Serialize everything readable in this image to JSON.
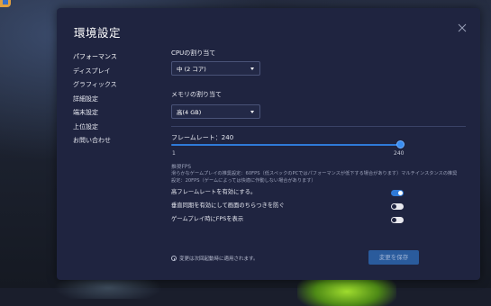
{
  "dialog": {
    "title": "環境設定"
  },
  "nav": {
    "items": [
      {
        "label": "パフォーマンス",
        "active": true
      },
      {
        "label": "ディスプレイ"
      },
      {
        "label": "グラフィックス"
      },
      {
        "label": "詳細設定"
      },
      {
        "label": "端末設定"
      },
      {
        "label": "上位設定"
      },
      {
        "label": "お問い合わせ"
      }
    ]
  },
  "cpu": {
    "label": "CPUの割り当て",
    "value": "中 (2 コア)"
  },
  "memory": {
    "label": "メモリの割り当て",
    "value": "高(4 GB)"
  },
  "frame_rate": {
    "label": "フレームレート：240",
    "min": "1",
    "max": "240",
    "value": 240
  },
  "recommended": {
    "title": "推奨FPS",
    "text": "滑らかなゲームプレイの推奨設定：60FPS（低スペックのPCではパフォーマンスが低下する場合があります）マルチインスタンスの推奨設定：20FPS（ゲームによっては快適に作動しない場合があります）"
  },
  "toggles": [
    {
      "label": "高フレームレートを有効にする。",
      "on": true
    },
    {
      "label": "垂直同期を有効にして画面のちらつきを防ぐ",
      "on": false
    },
    {
      "label": "ゲームプレイ時にFPSを表示",
      "on": false
    }
  ],
  "footer": {
    "note": "変更は次回起動時に適用されます。",
    "save_label": "変更を保存"
  },
  "colors": {
    "accent": "#2f7ad8",
    "panel": "#1f2440",
    "save_button": "#2a5b9c"
  }
}
